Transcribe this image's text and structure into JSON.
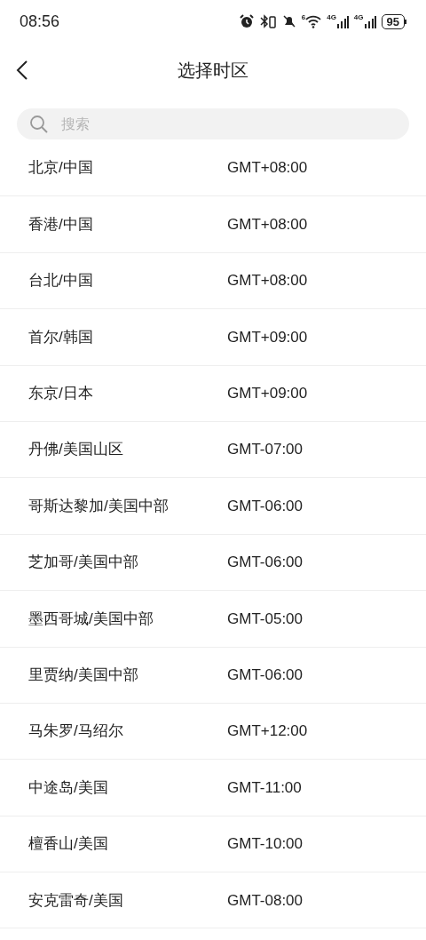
{
  "status_bar": {
    "time": "08:56",
    "wifi_label": "6",
    "signal_labels": [
      "4G",
      "4G"
    ],
    "battery": "95"
  },
  "header": {
    "title": "选择时区"
  },
  "search": {
    "placeholder": "搜索"
  },
  "zones": [
    {
      "name": "北京/中国",
      "offset": "GMT+08:00"
    },
    {
      "name": "香港/中国",
      "offset": "GMT+08:00"
    },
    {
      "name": "台北/中国",
      "offset": "GMT+08:00"
    },
    {
      "name": "首尔/韩国",
      "offset": "GMT+09:00"
    },
    {
      "name": "东京/日本",
      "offset": "GMT+09:00"
    },
    {
      "name": "丹佛/美国山区",
      "offset": "GMT-07:00"
    },
    {
      "name": "哥斯达黎加/美国中部",
      "offset": "GMT-06:00"
    },
    {
      "name": "芝加哥/美国中部",
      "offset": "GMT-06:00"
    },
    {
      "name": "墨西哥城/美国中部",
      "offset": "GMT-05:00"
    },
    {
      "name": "里贾纳/美国中部",
      "offset": "GMT-06:00"
    },
    {
      "name": "马朱罗/马绍尔",
      "offset": "GMT+12:00"
    },
    {
      "name": "中途岛/美国",
      "offset": "GMT-11:00"
    },
    {
      "name": "檀香山/美国",
      "offset": "GMT-10:00"
    },
    {
      "name": "安克雷奇/美国",
      "offset": "GMT-08:00"
    }
  ]
}
